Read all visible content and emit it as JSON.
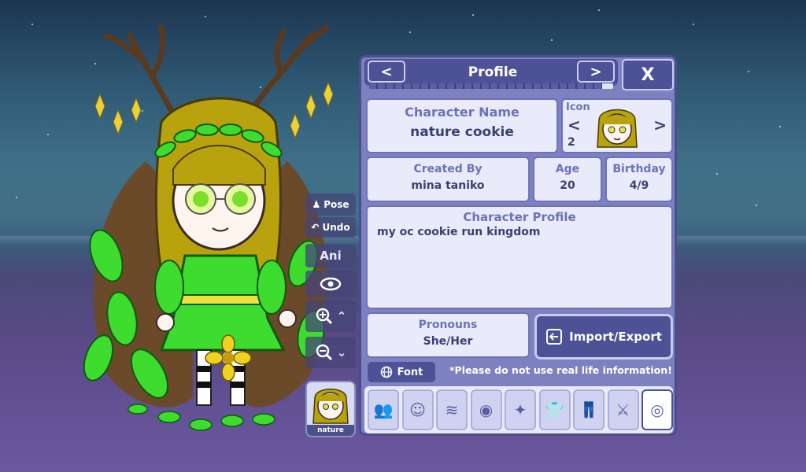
{
  "panel": {
    "title": "Profile",
    "prev": "<",
    "next": ">",
    "close": "X",
    "progress_fraction": 0.95
  },
  "character_name": {
    "label": "Character Name",
    "value": "nature cookie"
  },
  "icon": {
    "label": "Icon",
    "index": "2",
    "prev": "<",
    "next": ">"
  },
  "created_by": {
    "label": "Created By",
    "value": "mina taniko"
  },
  "age": {
    "label": "Age",
    "value": "20"
  },
  "birthday": {
    "label": "Birthday",
    "value": "4/9"
  },
  "profile": {
    "label": "Character Profile",
    "value": "my oc cookie run kingdom"
  },
  "pronouns": {
    "label": "Pronouns",
    "value": "She/Her"
  },
  "import_export": {
    "label": "Import/Export"
  },
  "font": {
    "label": "Font"
  },
  "notice": "*Please do not use real life information!",
  "toolbar": {
    "pose": "Pose",
    "undo": "Undo",
    "ani": "Ani"
  },
  "thumbnail": {
    "label": "nature cookie"
  },
  "colors": {
    "accent": "#4d5297",
    "panel": "#7d81bf",
    "box": "#e9ebfa",
    "label": "#6d72b6"
  },
  "categories": [
    "group-icon",
    "body-icon",
    "hair-icon",
    "face-icon",
    "accessory-icon",
    "top-icon",
    "bottom-icon",
    "props-icon",
    "profile-icon"
  ]
}
